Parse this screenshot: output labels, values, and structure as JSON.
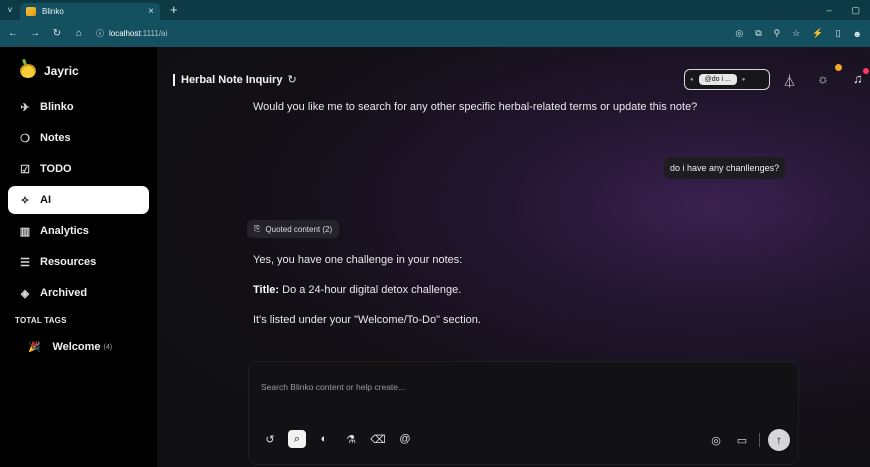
{
  "browser": {
    "tab_title": "Blinko",
    "tab_close": "×",
    "new_tab": "+",
    "menu_chevron": "˅",
    "minimize": "–",
    "maximize": "▢",
    "url_host": "localhost",
    "url_path": ":1111/ai"
  },
  "sidebar": {
    "user_name": "Jayric",
    "items": [
      {
        "label": "Blinko",
        "icon": "✈"
      },
      {
        "label": "Notes",
        "icon": "❍"
      },
      {
        "label": "TODO",
        "icon": "☑"
      },
      {
        "label": "AI",
        "icon": "✧"
      },
      {
        "label": "Analytics",
        "icon": "▥"
      },
      {
        "label": "Resources",
        "icon": "☰"
      },
      {
        "label": "Archived",
        "icon": "◈"
      }
    ],
    "tags_title": "TOTAL TAGS",
    "tags": [
      {
        "label": "Welcome",
        "count": "(4)",
        "icon": "🎉"
      }
    ]
  },
  "header": {
    "title": "Herbal Note Inquiry",
    "filter_chip": "@do i ..."
  },
  "conversation": {
    "ai_followup": "Would you like me to search for any other specific herbal-related terms or update this note?",
    "user_message": "do i have any chanllenges?",
    "quoted_label": "Quoted content (2)",
    "reply_line1": "Yes, you have one challenge in your notes:",
    "reply_title_label": "Title:",
    "reply_title_value": "Do a 24-hour digital detox challenge.",
    "reply_line3": "It's listed under your \"Welcome/To-Do\" section."
  },
  "composer": {
    "placeholder": "Search Blinko content or help create..."
  },
  "colors": {
    "sidebar_bg": "#000000",
    "active_nav_bg": "#ffffff",
    "chrome_bg": "#155060",
    "accent_badge": "#f5a623",
    "notification_badge": "#ff3b5c"
  }
}
